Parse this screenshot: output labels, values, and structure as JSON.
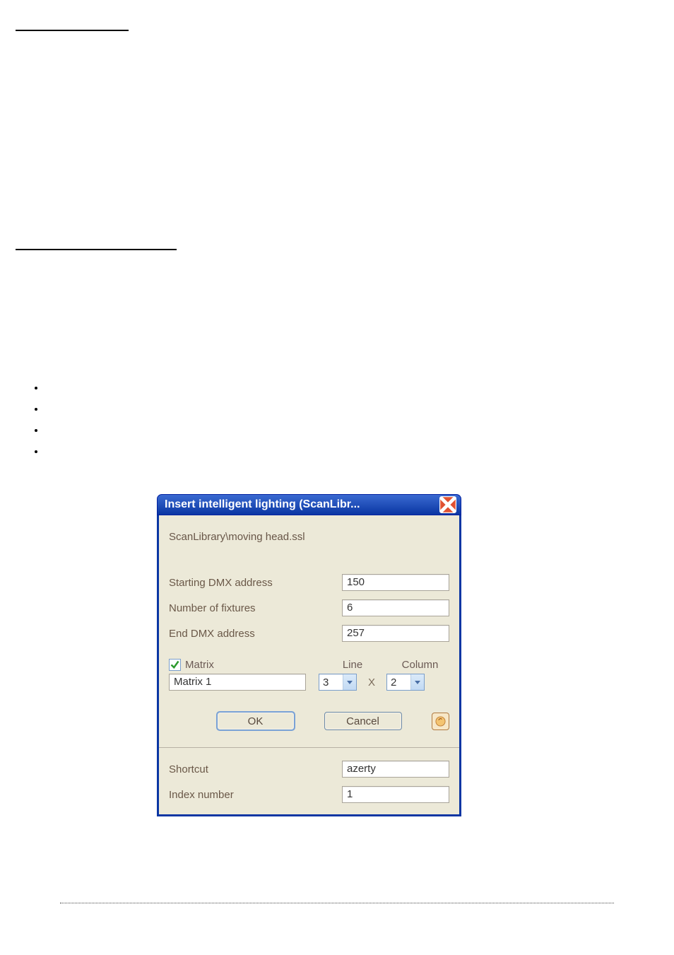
{
  "dialog": {
    "title": "Insert intelligent lighting (ScanLibr...",
    "file_path": "ScanLibrary\\moving head.ssl",
    "fields": {
      "starting_dmx_label": "Starting DMX address",
      "starting_dmx_value": "150",
      "num_fixtures_label": "Number of fixtures",
      "num_fixtures_value": "6",
      "end_dmx_label": "End DMX address",
      "end_dmx_value": "257"
    },
    "matrix": {
      "checkbox_label": "Matrix",
      "checked": true,
      "line_heading": "Line",
      "column_heading": "Column",
      "name_value": "Matrix 1",
      "line_value": "3",
      "x_label": "X",
      "column_value": "2"
    },
    "buttons": {
      "ok": "OK",
      "cancel": "Cancel"
    },
    "extra": {
      "shortcut_label": "Shortcut",
      "shortcut_value": "azerty",
      "index_label": "Index number",
      "index_value": "1"
    }
  }
}
